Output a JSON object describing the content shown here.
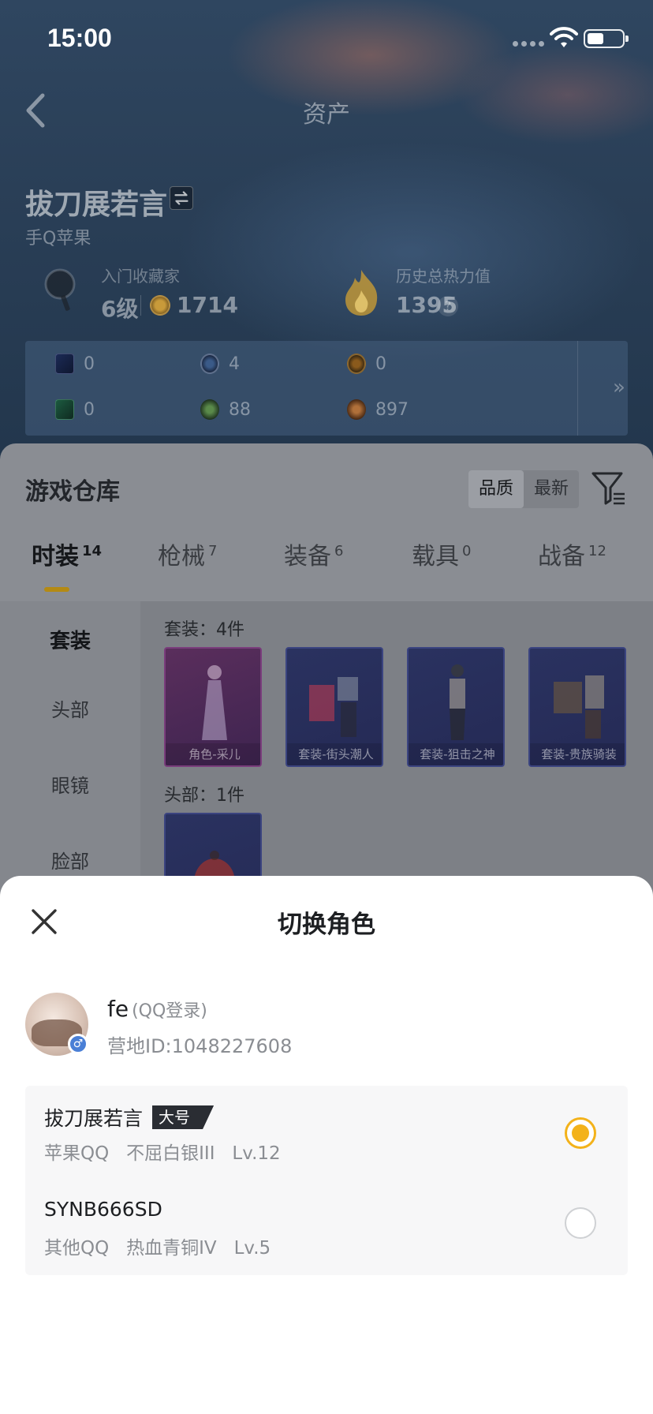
{
  "status_bar": {
    "time": "15:00"
  },
  "nav": {
    "title": "资产"
  },
  "profile": {
    "name": "拔刀展若言",
    "platform": "手Q苹果",
    "online_status": "",
    "collector_label": "入门收藏家",
    "collector_level": "6级",
    "collector_points": "1714",
    "heat_label": "历史总热力值",
    "heat_value": "1395",
    "help": "?"
  },
  "currencies": {
    "row1": [
      "0",
      "4",
      "0"
    ],
    "row2": [
      "0",
      "88",
      "897"
    ],
    "more": "»"
  },
  "warehouse": {
    "title": "游戏仓库",
    "sort": [
      "品质",
      "最新"
    ],
    "tabs": [
      {
        "label": "时装",
        "count": "14"
      },
      {
        "label": "枪械",
        "count": "7"
      },
      {
        "label": "装备",
        "count": "6"
      },
      {
        "label": "载具",
        "count": "0"
      },
      {
        "label": "战备",
        "count": "12"
      }
    ],
    "side_nav": [
      "套装",
      "头部",
      "眼镜",
      "脸部"
    ],
    "sections": [
      {
        "label": "套装：4件",
        "items": [
          "角色-采儿",
          "套装-街头潮人",
          "套装-狙击之神",
          "套装-贵族骑装"
        ]
      },
      {
        "label": "头部：1件",
        "items": [
          ""
        ]
      }
    ]
  },
  "sheet": {
    "title": "切换角色",
    "user": {
      "name": "fe",
      "login": "(QQ登录)",
      "camp_id": "营地ID:1048227608",
      "gender": "♂"
    },
    "roles": [
      {
        "name": "拔刀展若言",
        "tag": "大号",
        "detail": "苹果QQ   不屈白银III   Lv.12",
        "selected": true
      },
      {
        "name": "SYNB666SD",
        "tag": "",
        "detail": "其他QQ   热血青铜IV   Lv.5",
        "selected": false
      }
    ]
  },
  "colors": {
    "accent": "#f3b21a",
    "tab_underline": "#b48a14",
    "gender_badge": "#4a7fd6"
  }
}
